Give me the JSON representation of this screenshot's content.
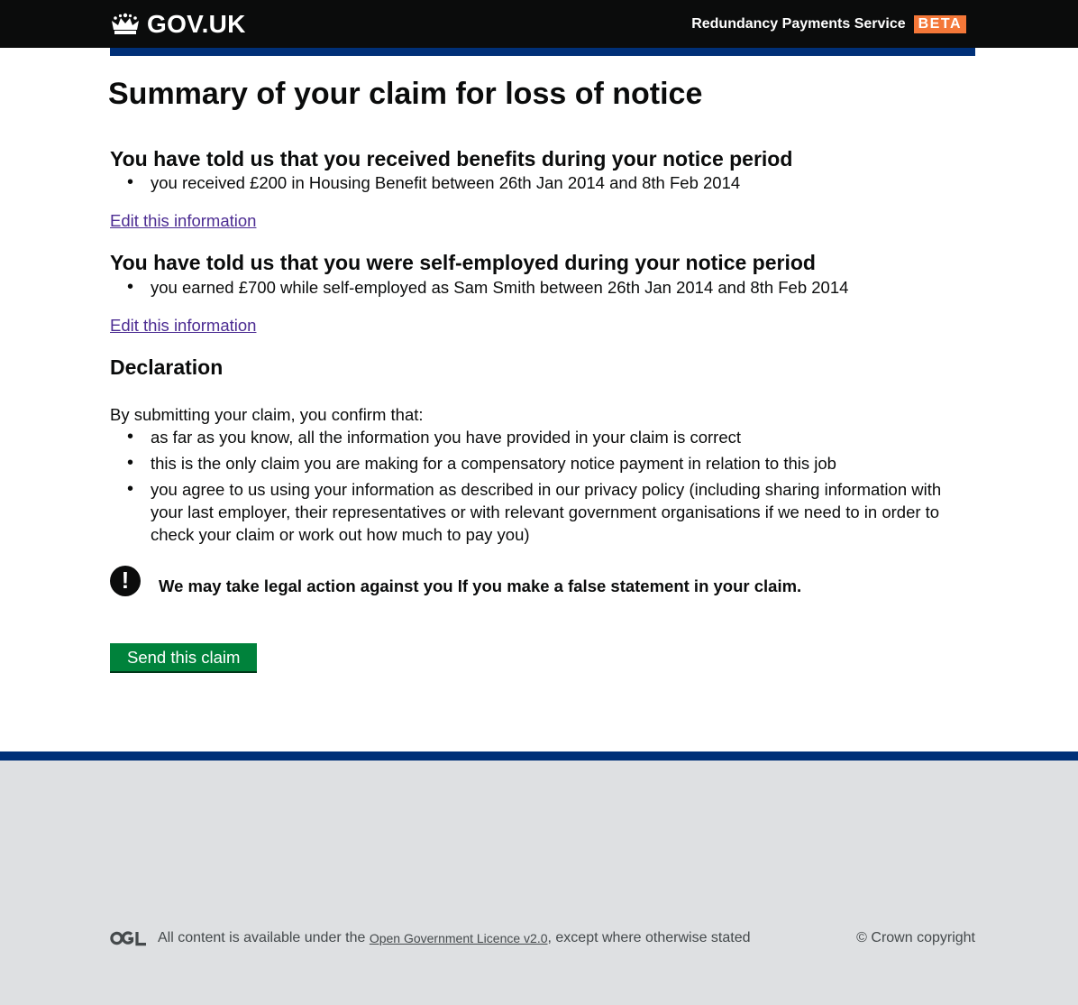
{
  "header": {
    "logo_text": "GOV.UK",
    "service_name": "Redundancy Payments Service",
    "phase_tag": "BETA",
    "icons": {
      "logo": "crown-icon"
    }
  },
  "main": {
    "title": "Summary of your claim for loss of notice",
    "benefits": {
      "heading": "You have told us that you received benefits during your notice period",
      "items": [
        "you received £200 in Housing Benefit between 26th Jan 2014 and 8th Feb 2014"
      ],
      "edit_link": "Edit this information"
    },
    "self_employed": {
      "heading": "You have told us that you were self-employed during your notice period",
      "items": [
        "you earned £700 while self-employed as Sam Smith between 26th Jan 2014 and 8th Feb 2014"
      ],
      "edit_link": "Edit this information"
    },
    "declaration": {
      "heading": "Declaration",
      "intro": "By submitting your claim, you confirm that:",
      "items": [
        "as far as you know, all the information you have provided in your claim is correct",
        "this is the only claim you are making for a compensatory notice payment in relation to this job",
        "you agree to us using your information as described in our privacy policy (including sharing information with your last employer, their representatives or with relevant government organisations if we need to in order to check your claim or work out how much to pay you)"
      ]
    },
    "warning": {
      "icon_glyph": "!",
      "text": "We may take legal action against you If you make a false statement in your claim."
    },
    "submit_label": "Send this claim"
  },
  "footer": {
    "licence_prefix": "All content is available under the",
    "licence_link": "Open Government Licence v2.0",
    "licence_suffix": ", except where otherwise stated",
    "copyright": "© Crown copyright",
    "icons": {
      "licence_logo": "ogl-icon"
    }
  },
  "colors": {
    "header_bg": "#0b0c0c",
    "accent_blue": "#003078",
    "beta_tag": "#f47738",
    "button_green": "#00823b",
    "link": "#4c2c92",
    "footer_bg": "#dee0e2"
  }
}
